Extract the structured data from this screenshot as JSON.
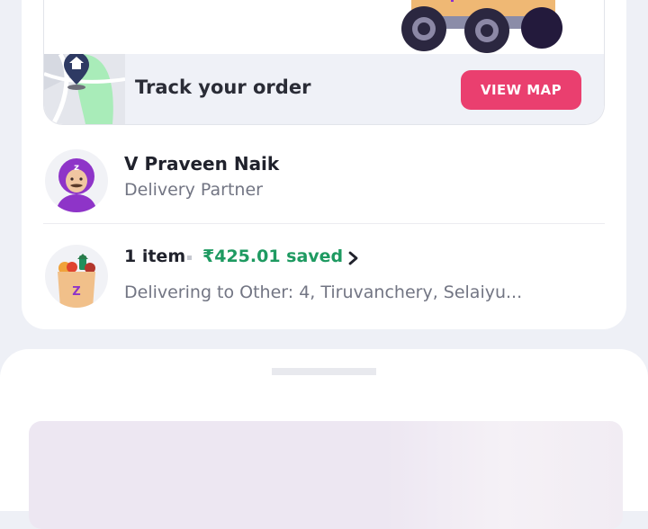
{
  "track": {
    "label": "Track your order",
    "button_label": "VIEW MAP"
  },
  "partner": {
    "name": "V Praveen Naik",
    "role": "Delivery Partner",
    "avatar_letter": "z"
  },
  "order": {
    "item_count": "1 item",
    "saved": "₹425.01 saved",
    "address": "Delivering to Other: 4, Tiruvanchery, Selaiyu...",
    "bag_letter": "Z"
  },
  "colors": {
    "accent": "#ea3f6f",
    "saved_green": "#1e9a61",
    "background": "#eef0f6"
  },
  "icons": [
    "delivery-truck-icon",
    "map-pin-home-icon",
    "chevron-right-icon",
    "grocery-bag-icon",
    "delivery-partner-avatar"
  ]
}
